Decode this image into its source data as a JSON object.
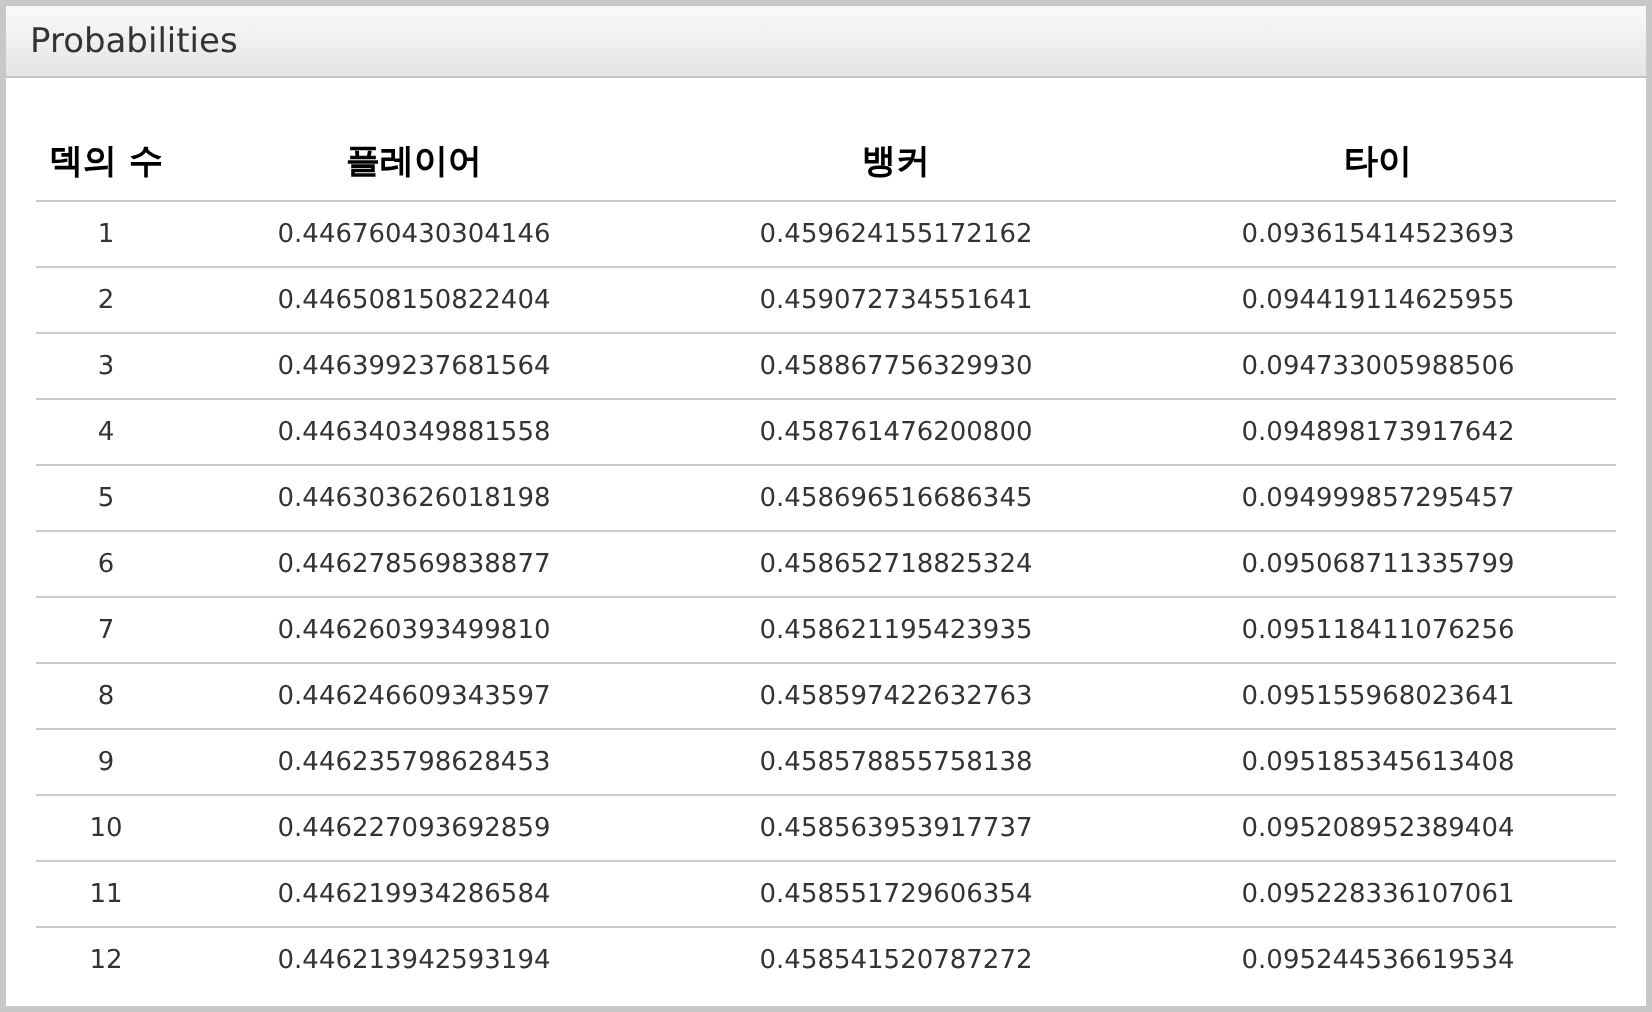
{
  "panel": {
    "title": "Probabilities"
  },
  "table": {
    "columns": [
      "덱의 수",
      "플레이어",
      "뱅커",
      "타이"
    ],
    "rows": [
      [
        "1",
        "0.446760430304146",
        "0.459624155172162",
        "0.093615414523693"
      ],
      [
        "2",
        "0.446508150822404",
        "0.459072734551641",
        "0.094419114625955"
      ],
      [
        "3",
        "0.446399237681564",
        "0.458867756329930",
        "0.094733005988506"
      ],
      [
        "4",
        "0.446340349881558",
        "0.458761476200800",
        "0.094898173917642"
      ],
      [
        "5",
        "0.446303626018198",
        "0.458696516686345",
        "0.094999857295457"
      ],
      [
        "6",
        "0.446278569838877",
        "0.458652718825324",
        "0.095068711335799"
      ],
      [
        "7",
        "0.446260393499810",
        "0.458621195423935",
        "0.095118411076256"
      ],
      [
        "8",
        "0.446246609343597",
        "0.458597422632763",
        "0.095155968023641"
      ],
      [
        "9",
        "0.446235798628453",
        "0.458578855758138",
        "0.095185345613408"
      ],
      [
        "10",
        "0.446227093692859",
        "0.458563953917737",
        "0.095208952389404"
      ],
      [
        "11",
        "0.446219934286584",
        "0.458551729606354",
        "0.095228336107061"
      ],
      [
        "12",
        "0.446213942593194",
        "0.458541520787272",
        "0.095244536619534"
      ]
    ]
  }
}
